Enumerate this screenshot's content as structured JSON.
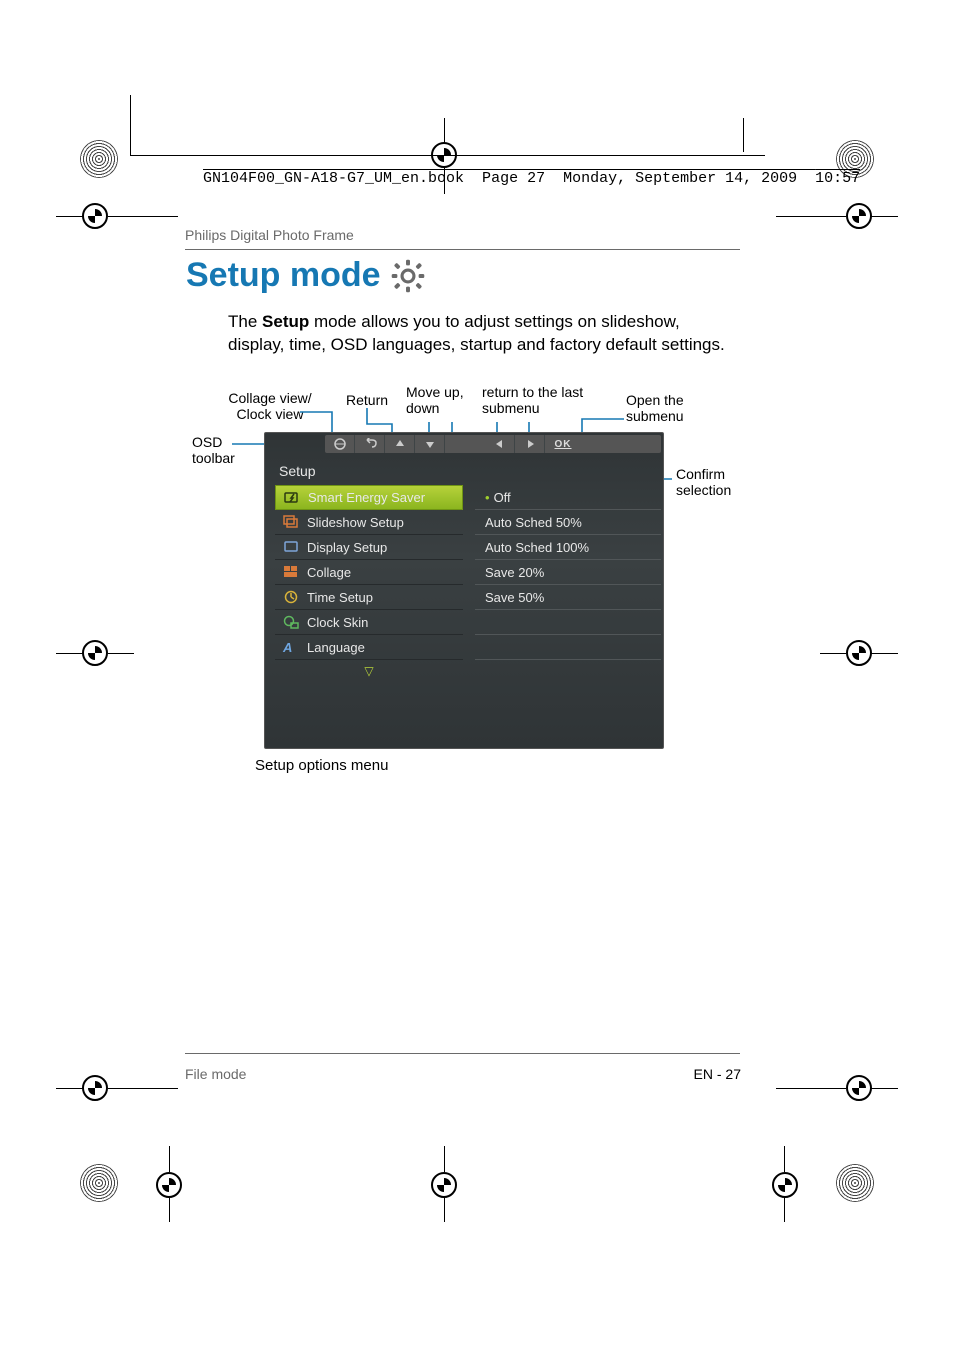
{
  "header_line": {
    "prefix": "GN104F00_GN-A18-G7_UM_en.book  Page 27  Monday, September 14, 2009  ",
    "time": "10:57"
  },
  "running_head": "Philips Digital Photo Frame",
  "title": "Setup mode",
  "body": {
    "pre": "The ",
    "bold": "Setup",
    "post": " mode allows you to adjust settings on slideshow, display, time, OSD languages, startup and factory default settings."
  },
  "labels": {
    "collage": "Collage view/\nClock view",
    "return": "Return",
    "moveupdown": "Move up,\ndown",
    "return_last": "return to the last\nsubmenu",
    "open_submenu": "Open the\nsubmenu",
    "confirm": "Confirm\nselection",
    "osd_toolbar": "OSD\ntoolbar",
    "setup_options_menu": "Setup options menu"
  },
  "osd": {
    "title": "Setup",
    "toolbar_ok": "OK",
    "menu": [
      "Smart Energy Saver",
      "Slideshow Setup",
      "Display Setup",
      "Collage",
      "Time Setup",
      "Clock Skin",
      "Language"
    ],
    "submenu": [
      "Off",
      "Auto Sched 50%",
      "Auto Sched 100%",
      "Save 20%",
      "Save 50%"
    ]
  },
  "caption": "Setup options menu",
  "footer": {
    "left": "File mode",
    "right": "EN - 27"
  }
}
